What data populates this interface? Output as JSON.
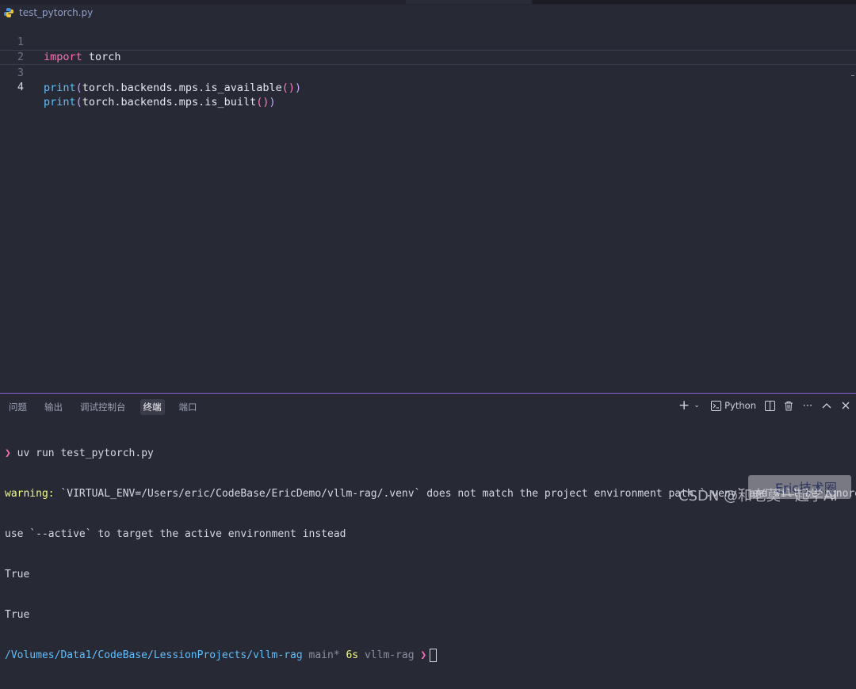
{
  "editor": {
    "file_tab": "test_pytorch.py",
    "lines": [
      {
        "n": "1",
        "parts": [
          {
            "t": "import",
            "c": "kw"
          },
          {
            "t": " torch",
            "c": "id"
          }
        ]
      },
      {
        "n": "2",
        "parts": []
      },
      {
        "n": "3",
        "parts": [
          {
            "t": "print",
            "c": "fn"
          },
          {
            "t": "(",
            "c": "par"
          },
          {
            "t": "torch.backends.mps.is_available",
            "c": "id"
          },
          {
            "t": "()",
            "c": "par2"
          },
          {
            "t": ")",
            "c": "par"
          }
        ]
      },
      {
        "n": "4",
        "parts": [
          {
            "t": "print",
            "c": "fn"
          },
          {
            "t": "(",
            "c": "par"
          },
          {
            "t": "torch.backends.mps.is_built",
            "c": "id"
          },
          {
            "t": "()",
            "c": "par2"
          },
          {
            "t": ")",
            "c": "par"
          }
        ]
      }
    ]
  },
  "panel": {
    "tabs": [
      "问题",
      "输出",
      "调试控制台",
      "终端",
      "端口"
    ],
    "selected_tab": "终端",
    "python_label": "Python"
  },
  "terminal": {
    "prompt_symbol": "❯",
    "command": "uv run test_pytorch.py",
    "warning_label": "warning:",
    "warning_text": " `VIRTUAL_ENV=/Users/eric/CodeBase/EricDemo/vllm-rag/.venv` does not match the project environment path `.venv` and will be ignored;",
    "warning_text2": "use `--active` to target the active environment instead",
    "out1": "True",
    "out2": "True",
    "path": "/Volumes/Data1/CodeBase/LessionProjects/vllm-rag",
    "branch": "main*",
    "duration": "6s",
    "venv": "vllm-rag"
  },
  "watermark": {
    "csdn": "CSDN @和老莫一起学AI",
    "eric": "Eric技术圈"
  }
}
